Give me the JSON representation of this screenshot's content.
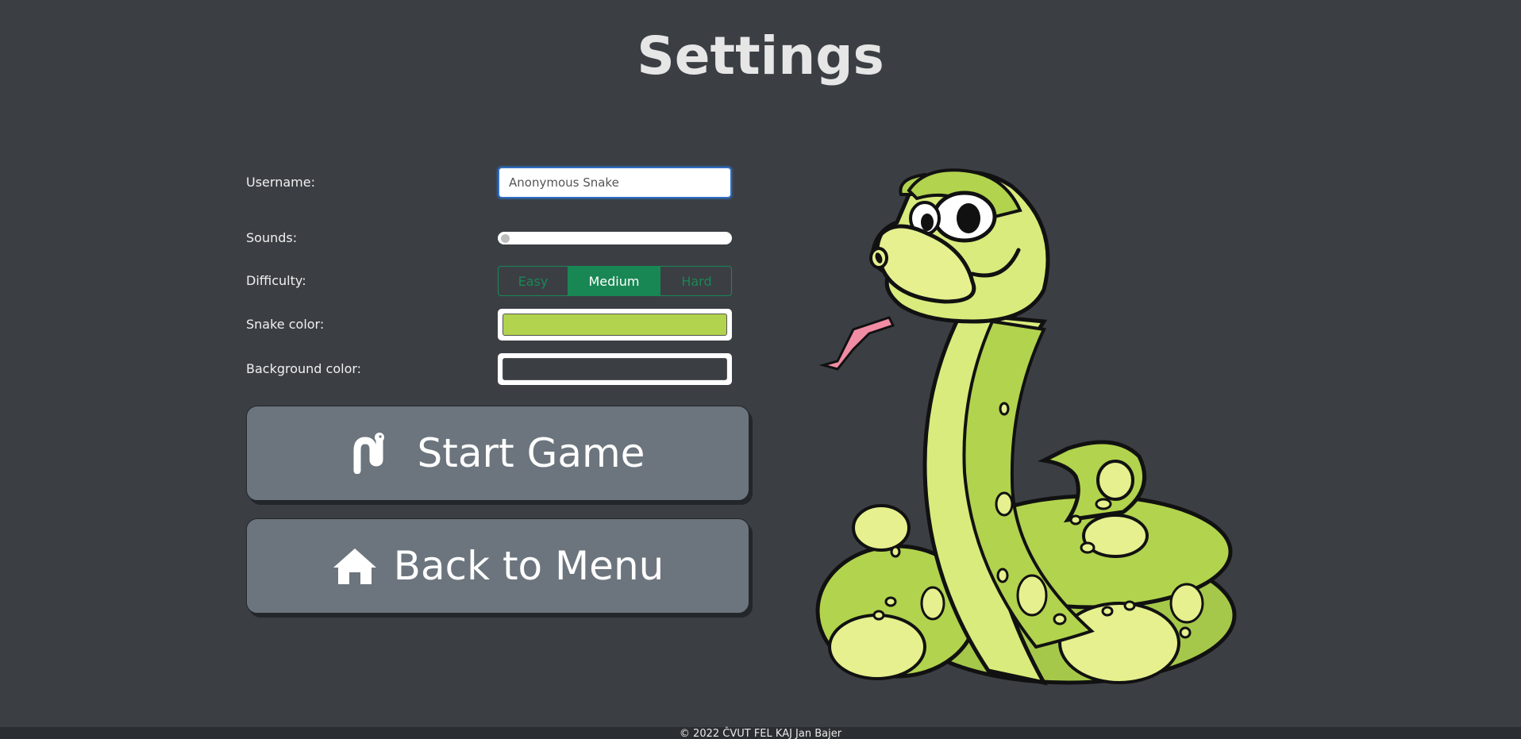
{
  "page": {
    "title": "Settings"
  },
  "form": {
    "username_label": "Username:",
    "username_value": "Anonymous Snake",
    "sounds_label": "Sounds:",
    "sounds_level": 0,
    "difficulty_label": "Difficulty:",
    "difficulty_options": [
      "Easy",
      "Medium",
      "Hard"
    ],
    "difficulty_selected": "Medium",
    "snake_color_label": "Snake color:",
    "snake_color": "#b2d34e",
    "background_color_label": "Background color:",
    "background_color": "#3b3f44"
  },
  "buttons": {
    "start_label": "Start Game",
    "start_icon": "snake-icon",
    "back_label": "Back to Menu",
    "back_icon": "home-icon"
  },
  "footer": {
    "text": "© 2022 ČVUT FEL KAJ Jan Bajer"
  },
  "colors": {
    "background": "#3b3f44",
    "accent_green": "#198754",
    "button_gray": "#6c757d"
  }
}
